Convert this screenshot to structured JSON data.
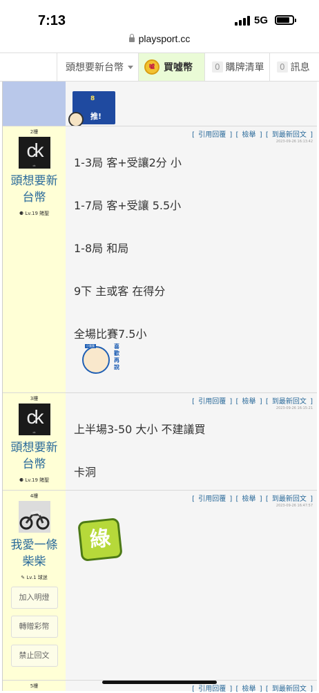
{
  "status": {
    "time": "7:13",
    "network": "5G"
  },
  "browser": {
    "url": "playsport.cc"
  },
  "nav": {
    "user": "頭想要新台幣",
    "coin": "買噓幣",
    "coin_icon_text": "噓",
    "cart_count": "0",
    "cart": "購牌清單",
    "msg_count": "0",
    "msg": "訊息"
  },
  "first_post": {
    "push_count": "8",
    "push_label": "推!"
  },
  "posts": [
    {
      "floor": "2樓",
      "avatar_text": "ck",
      "avatar_sub": "ck",
      "name": "頭想要新台幣",
      "level": "Lv.19 賭聖",
      "actions": [
        "[ 引用回覆 ]",
        "[ 檢舉 ]",
        "[ 到最新回文 ]"
      ],
      "timestamp": "2023-09-26 16:13:42",
      "lines": [
        "1-3局 客+受讓2分 小",
        "1-7局 客+受讓 5.5小",
        "1-8局 和局",
        "9下 主或客 在得分",
        "全場比賽7.5小"
      ],
      "sticker": [
        "喜",
        "歡",
        "再",
        "說"
      ],
      "sticker_tag": "小蛋蛋"
    },
    {
      "floor": "3樓",
      "avatar_text": "ck",
      "avatar_sub": "ck",
      "name": "頭想要新台幣",
      "level": "Lv.19 賭聖",
      "actions": [
        "[ 引用回覆 ]",
        "[ 檢舉 ]",
        "[ 到最新回文 ]"
      ],
      "timestamp": "2023-09-26 16:15:21",
      "lines": [
        "上半場3-50 大小 不建議買",
        "卡洞"
      ]
    },
    {
      "floor": "4樓",
      "name": "我愛一條柴柴",
      "level": "Lv.1 球迷",
      "actions": [
        "[ 引用回覆 ]",
        "[ 檢舉 ]",
        "[ 到最新回文 ]"
      ],
      "timestamp": "2023-09-26 16:47:57",
      "sticker_text": "綠",
      "buttons": [
        "加入明燈",
        "轉贈彩幣",
        "禁止回文"
      ]
    },
    {
      "floor": "5樓",
      "actions": [
        "[ 引用回覆 ]",
        "[ 檢舉 ]",
        "[ 到最新回文 ]"
      ]
    }
  ],
  "colors": {
    "sidebar_bg": "#ffffd6",
    "link": "#2a6a9a",
    "nav_highlight": "#eafbd6",
    "body_bg": "#f5f5f5"
  }
}
